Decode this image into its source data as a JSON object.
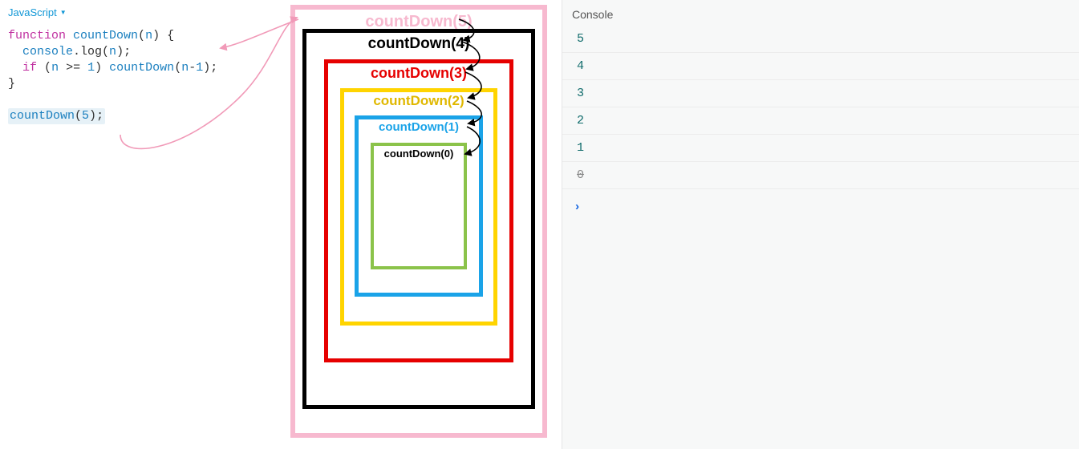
{
  "code_pane": {
    "language_label": "JavaScript",
    "code_tokens": {
      "kw_function": "function",
      "fn_name": "countDown",
      "param": "n",
      "open_brace": "{",
      "log_stmt_a": "console",
      "log_stmt_b": ".log(",
      "log_stmt_c": ");",
      "kw_if": "if",
      "cond_open": "(",
      "cond_op": ">=",
      "cond_rhs": "1",
      "cond_close": ")",
      "recurse_call": "countDown",
      "recurse_arg_a": "(",
      "recurse_arg_b": "n",
      "recurse_arg_c": "-",
      "recurse_arg_d": "1",
      "recurse_arg_e": ");",
      "close_brace": "}",
      "initial_call": "countDown",
      "initial_arg": "5",
      "initial_end": ";"
    }
  },
  "diagram": {
    "frames": [
      {
        "label": "countDown(5)",
        "color": "#f7b9cf"
      },
      {
        "label": "countDown(4)",
        "color": "#000000"
      },
      {
        "label": "countDown(3)",
        "color": "#e60000"
      },
      {
        "label": "countDown(2)",
        "color": "#ffd400"
      },
      {
        "label": "countDown(1)",
        "color": "#1aa3e8"
      },
      {
        "label": "countDown(0)",
        "color": "#8bc34a"
      }
    ]
  },
  "console": {
    "title": "Console",
    "lines": [
      "5",
      "4",
      "3",
      "2",
      "1",
      "0"
    ],
    "prompt_glyph": "›"
  }
}
